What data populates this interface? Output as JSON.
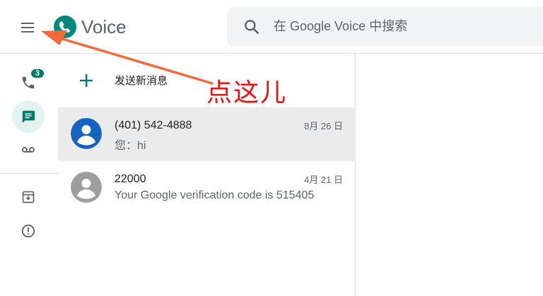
{
  "header": {
    "app_name": "Voice",
    "search_placeholder": "在 Google Voice 中搜索"
  },
  "rail": {
    "calls_badge": "3"
  },
  "compose": {
    "label": "发送新消息"
  },
  "conversations": [
    {
      "name": "(401) 542-4888",
      "snippet": "您：hi",
      "date": "8月 26 日",
      "avatar_color": "#1565c0",
      "selected": true
    },
    {
      "name": "22000",
      "snippet": "Your Google verification code is 515405",
      "date": "4月 21 日",
      "avatar_color": "#9e9e9e",
      "selected": false
    }
  ],
  "annotation": {
    "text": "点这儿",
    "color": "#ee1111"
  },
  "colors": {
    "accent": "#00796b",
    "active_bg": "#e3f2f1"
  }
}
